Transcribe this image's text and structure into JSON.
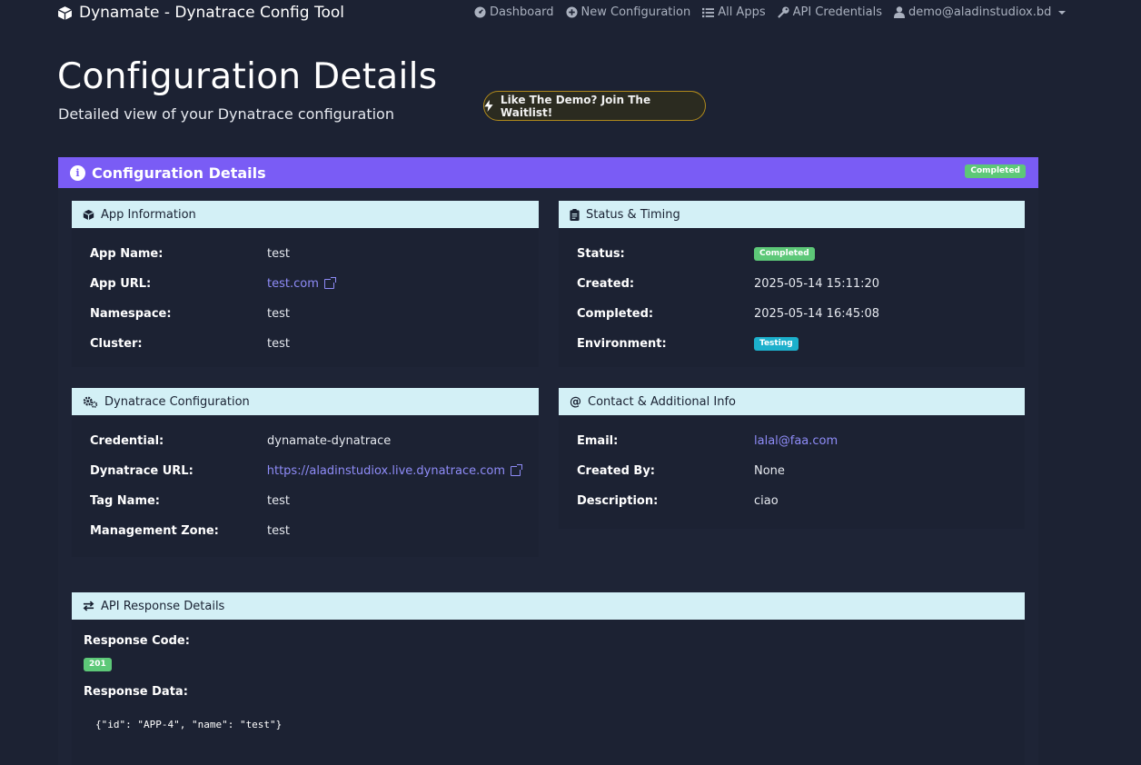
{
  "navbar": {
    "brand": "Dynamate - Dynatrace Config Tool",
    "brand_icon": "cube-icon",
    "items": [
      {
        "label": "Dashboard",
        "icon": "gauge-icon"
      },
      {
        "label": "New Configuration",
        "icon": "plus-circle-icon"
      },
      {
        "label": "All Apps",
        "icon": "list-icon"
      },
      {
        "label": "API Credentials",
        "icon": "key-icon"
      },
      {
        "label": "demo@aladinstudiox.bd",
        "icon": "user-icon"
      }
    ]
  },
  "header": {
    "title": "Configuration Details",
    "subtitle": "Detailed view of your Dynatrace configuration",
    "waitlist_label": "Like The Demo? Join The Waitlist!"
  },
  "main": {
    "title": "Configuration Details",
    "status_badge": "Completed",
    "colors": {
      "accent": "#7a5cf5",
      "section_header": "#d3f0f6",
      "success": "#5dc878",
      "info": "#1cb0cc",
      "link": "#8f8cf8"
    }
  },
  "app_info": {
    "title": "App Information",
    "rows": [
      {
        "label": "App Name:",
        "value": "test"
      },
      {
        "label": "App URL:",
        "value": "test.com"
      },
      {
        "label": "Namespace:",
        "value": "test"
      },
      {
        "label": "Cluster:",
        "value": "test"
      }
    ]
  },
  "status_timing": {
    "title": "Status & Timing",
    "rows": [
      {
        "label": "Status:",
        "value": "Completed"
      },
      {
        "label": "Created:",
        "value": "2025-05-14 15:11:20"
      },
      {
        "label": "Completed:",
        "value": "2025-05-14 16:45:08"
      },
      {
        "label": "Environment:",
        "value": "Testing"
      }
    ]
  },
  "dynatrace_config": {
    "title": "Dynatrace Configuration",
    "rows": [
      {
        "label": "Credential:",
        "value": "dynamate-dynatrace"
      },
      {
        "label": "Dynatrace URL:",
        "value": "https://aladinstudiox.live.dynatrace.com"
      },
      {
        "label": "Tag Name:",
        "value": "test"
      },
      {
        "label": "Management Zone:",
        "value": "test"
      }
    ]
  },
  "contact": {
    "title": "Contact & Additional Info",
    "rows": [
      {
        "label": "Email:",
        "value": "lalal@faa.com"
      },
      {
        "label": "Created By:",
        "value": "None"
      },
      {
        "label": "Description:",
        "value": "ciao"
      }
    ]
  },
  "api": {
    "title": "API Response Details",
    "response_code_label": "Response Code:",
    "response_code": "201",
    "response_data_label": "Response Data:",
    "response_data": "{\"id\": \"APP-4\", \"name\": \"test\"}"
  }
}
